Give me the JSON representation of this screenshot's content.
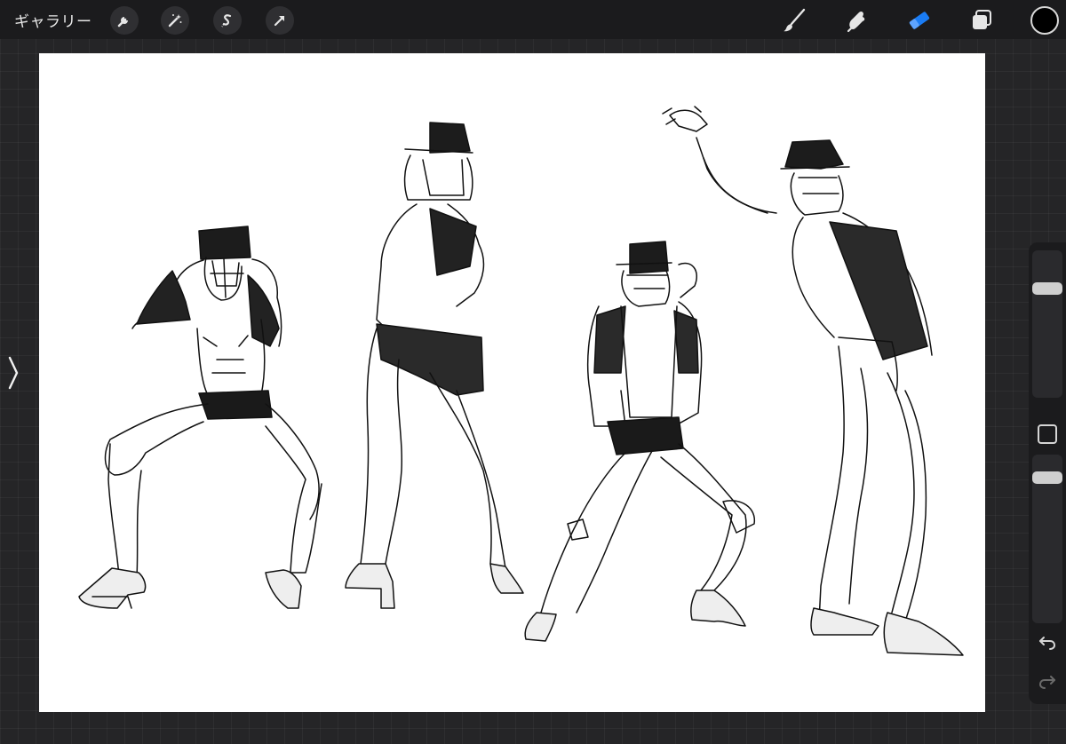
{
  "topbar": {
    "gallery_label": "ギャラリー",
    "left_tools": [
      "wrench-icon",
      "magic-wand-icon",
      "selection-icon",
      "transform-arrow-icon"
    ],
    "right_tools": [
      "brush-icon",
      "smudge-icon",
      "eraser-icon",
      "layers-icon"
    ],
    "active_tool": "eraser-icon",
    "active_color": "#1a7cf4",
    "current_color": "#000000"
  },
  "sidebar": {
    "brush_size_level": 0.9,
    "opacity_level": 0.7,
    "modify_button": "square-modify-icon",
    "undo_icon": "undo-icon",
    "redo_icon": "redo-icon"
  },
  "canvas": {
    "background": "#ffffff",
    "content": "four-dancer-figure-sketches"
  }
}
